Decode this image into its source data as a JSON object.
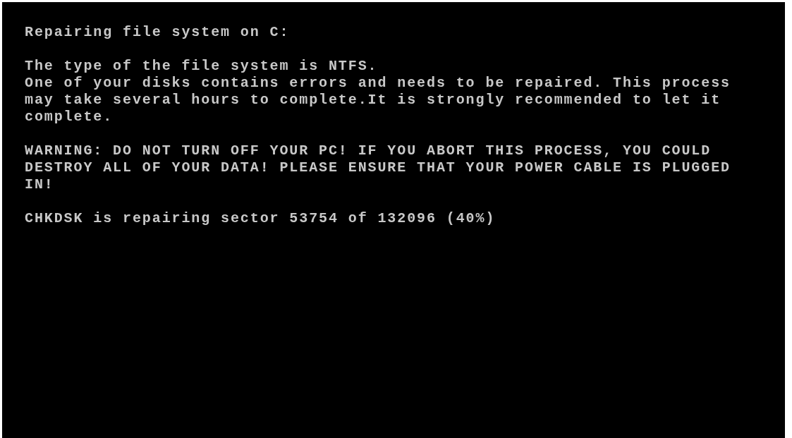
{
  "console": {
    "paragraphs": [
      {
        "lines": [
          "Repairing file system on C:"
        ]
      },
      {
        "lines": [
          "The type of the file system is NTFS.",
          "One of your disks contains errors and needs to be repaired. This process",
          "may take several hours to complete.It is strongly recommended to let it",
          "complete."
        ]
      },
      {
        "lines": [
          "WARNING: DO NOT TURN OFF YOUR PC! IF YOU ABORT THIS PROCESS, YOU COULD",
          "DESTROY ALL OF YOUR DATA! PLEASE ENSURE THAT YOUR POWER CABLE IS PLUGGED",
          "IN!"
        ]
      },
      {
        "lines": [
          "CHKDSK is repairing sector 53754 of 132096 (40%)"
        ]
      }
    ]
  }
}
